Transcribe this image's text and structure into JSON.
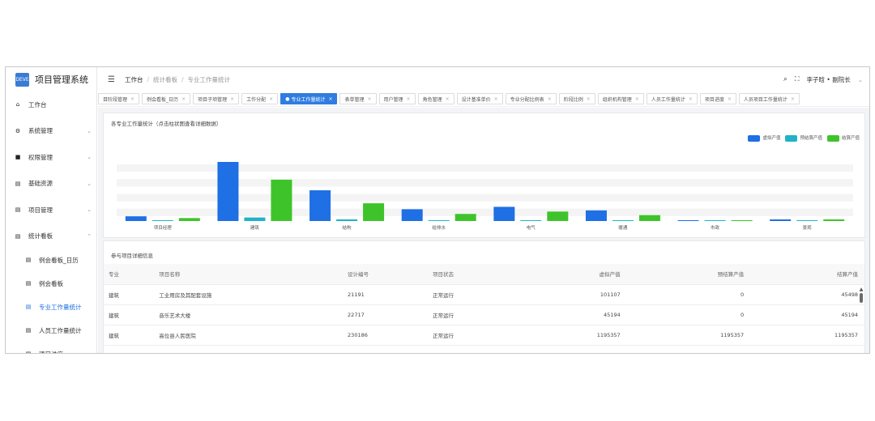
{
  "app": {
    "title": "项目管理系统",
    "logo_text": "DEVE",
    "accent": "#2f7de1"
  },
  "header": {
    "breadcrumbs": [
      "工作台",
      "统计看板",
      "专业工作量统计"
    ],
    "user": "李子晗 • 副院长"
  },
  "sidebar": {
    "items": [
      {
        "label": "工作台",
        "icon": "home-icon",
        "chevron": ""
      },
      {
        "label": "系统管理",
        "icon": "gear-icon",
        "chevron": "⌄"
      },
      {
        "label": "权限管理",
        "icon": "lock-icon",
        "chevron": "⌄"
      },
      {
        "label": "基础资源",
        "icon": "doc-icon",
        "chevron": "⌄"
      },
      {
        "label": "项目管理",
        "icon": "doc-icon",
        "chevron": "⌄"
      },
      {
        "label": "统计看板",
        "icon": "doc-icon",
        "chevron": "⌃"
      }
    ],
    "sub_items": [
      {
        "label": "例会看板_日历",
        "active": false
      },
      {
        "label": "例会看板",
        "active": false
      },
      {
        "label": "专业工作量统计",
        "active": true
      },
      {
        "label": "人员工作量统计",
        "active": false
      },
      {
        "label": "项目进度",
        "active": false
      }
    ]
  },
  "tabs": [
    {
      "label": "目阶段管理",
      "active": false
    },
    {
      "label": "例会看板_日历",
      "active": false
    },
    {
      "label": "项目子项管理",
      "active": false
    },
    {
      "label": "工作分配",
      "active": false
    },
    {
      "label": "专业工作量统计",
      "active": true
    },
    {
      "label": "表单管理",
      "active": false
    },
    {
      "label": "用户管理",
      "active": false
    },
    {
      "label": "角色管理",
      "active": false
    },
    {
      "label": "设计基准单价",
      "active": false
    },
    {
      "label": "专业分配比例表",
      "active": false
    },
    {
      "label": "阶段比例",
      "active": false
    },
    {
      "label": "组织机构管理",
      "active": false
    },
    {
      "label": "人员工作量统计",
      "active": false
    },
    {
      "label": "项目进度",
      "active": false
    },
    {
      "label": "人员项目工作量统计",
      "active": false
    }
  ],
  "chart_card": {
    "title": "各专业工作量统计（点击柱状图查看详细数据）"
  },
  "chart_data": {
    "type": "bar",
    "title": "各专业工作量统计（点击柱状图查看详细数据）",
    "categories": [
      "项目经理",
      "建筑",
      "结构",
      "给排水",
      "电气",
      "暖通",
      "市政",
      "景观"
    ],
    "series": [
      {
        "name": "虚拟产值",
        "color": "#1f6fe5",
        "values": [
          8,
          100,
          52,
          20,
          24,
          18,
          0,
          2
        ]
      },
      {
        "name": "预结算产值",
        "color": "#20b2c8",
        "values": [
          0,
          6,
          1,
          0,
          0,
          0,
          0,
          0
        ]
      },
      {
        "name": "结算产值",
        "color": "#3ec42a",
        "values": [
          5,
          70,
          30,
          12,
          16,
          10,
          0,
          1
        ]
      }
    ],
    "ylim": [
      0,
      100
    ],
    "legend": "top-right",
    "grid": true
  },
  "table_card": {
    "title": "参与项目详细信息",
    "columns": [
      "专业",
      "项目名称",
      "设计编号",
      "项目状态",
      "虚拟产值",
      "预结算产值",
      "结算产值"
    ],
    "rows": [
      [
        "建筑",
        "工业用房及其配套设施",
        "21191",
        "正常运行",
        "101107",
        "0",
        "45498"
      ],
      [
        "建筑",
        "音乐艺术大楼",
        "22717",
        "正常运行",
        "45194",
        "0",
        "45194"
      ],
      [
        "建筑",
        "高位县人民医院",
        "230186",
        "正常运行",
        "1195357",
        "1195357",
        "1195357"
      ]
    ]
  }
}
